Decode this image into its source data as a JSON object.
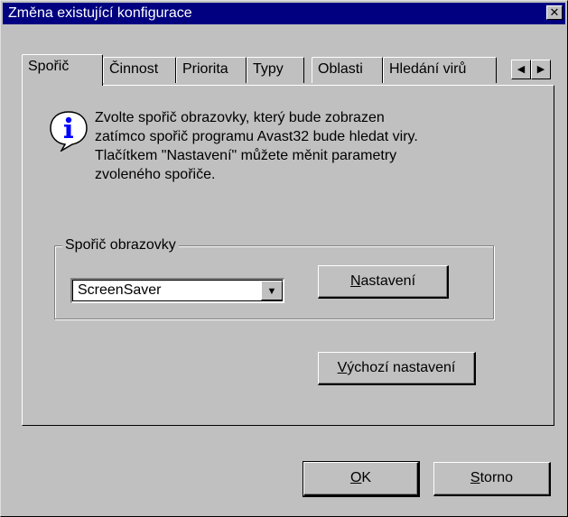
{
  "window": {
    "title": "Změna existující konfigurace",
    "close_glyph": "✕"
  },
  "tabs": [
    {
      "label": "Spořič",
      "active": true
    },
    {
      "label": "Činnost",
      "active": false
    },
    {
      "label": "Priorita",
      "active": false
    },
    {
      "label": "Typy",
      "active": false
    },
    {
      "label": "Oblasti",
      "active": false
    },
    {
      "label": "Hledání virů",
      "active": false
    }
  ],
  "tab_scroll": {
    "left_glyph": "◀",
    "right_glyph": "▶"
  },
  "info": {
    "icon": "info-icon",
    "lines": [
      "Zvolte spořič obrazovky, který bude zobrazen",
      "zatímco spořič programu Avast32 bude hledat viry.",
      "Tlačítkem \"Nastavení\" můžete měnit parametry",
      "zvoleného spořiče."
    ]
  },
  "screensaver_group": {
    "legend": "Spořič obrazovky",
    "selected": "ScreenSaver",
    "dropdown_glyph": "▼",
    "settings_button": {
      "mnemonic": "N",
      "rest": "astavení"
    }
  },
  "defaults_button": {
    "mnemonic": "V",
    "rest": "ýchozí nastavení"
  },
  "ok_button": {
    "mnemonic": "O",
    "rest": "K"
  },
  "cancel_button": {
    "mnemonic": "S",
    "rest": "torno"
  },
  "colors": {
    "titlebar": "#000080",
    "face": "#c0c0c0",
    "info_icon": "#0000ff"
  }
}
